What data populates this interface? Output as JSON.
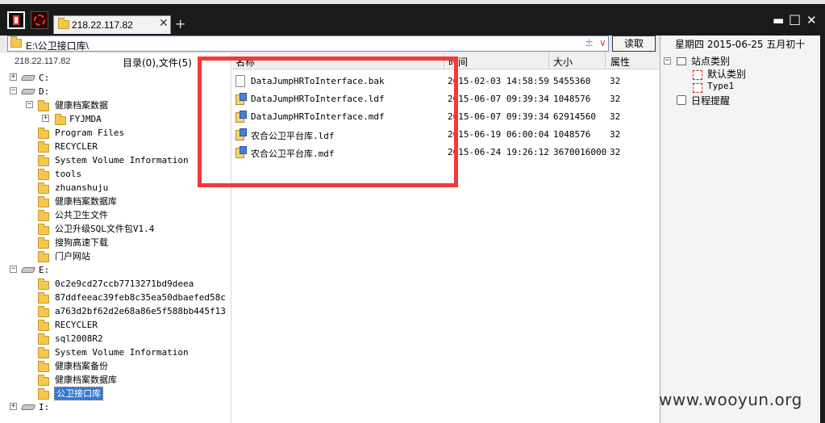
{
  "tab": {
    "title": "218.22.117.82",
    "close": "✕",
    "new_tab": "+"
  },
  "window_controls": {
    "minimize": "▬",
    "maximize": "□",
    "close": "✕"
  },
  "path": {
    "value": "E:\\公卫接口库\\",
    "plusminus": "±",
    "dropdown": "∨",
    "read_button": "读取"
  },
  "left": {
    "host": "218.22.117.82",
    "dir_count": "目录(0),文件(5)",
    "tree": [
      {
        "label": "C:",
        "type": "drive",
        "expander": "+"
      },
      {
        "label": "D:",
        "type": "drive",
        "expander": "−"
      },
      {
        "label": "健康档案数据",
        "type": "folder",
        "expander": "−"
      },
      {
        "label": "FYJMDA",
        "type": "folder",
        "expander": "+"
      },
      {
        "label": "Program Files",
        "type": "folder"
      },
      {
        "label": "RECYCLER",
        "type": "folder"
      },
      {
        "label": "System Volume Information",
        "type": "folder"
      },
      {
        "label": "tools",
        "type": "folder"
      },
      {
        "label": "zhuanshuju",
        "type": "folder"
      },
      {
        "label": "健康档案数据库",
        "type": "folder"
      },
      {
        "label": "公共卫生文件",
        "type": "folder"
      },
      {
        "label": "公卫升级SQL文件包V1.4",
        "type": "folder"
      },
      {
        "label": "搜狗高速下载",
        "type": "folder"
      },
      {
        "label": "门户网站",
        "type": "folder"
      },
      {
        "label": "E:",
        "type": "drive",
        "expander": "−"
      },
      {
        "label": "0c2e9cd27ccb7713271bd9deea",
        "type": "folder"
      },
      {
        "label": "87ddfeeac39feb8c35ea50dbaefed58c",
        "type": "folder"
      },
      {
        "label": "a763d2bf62d2e68a86e5f588bb445f13",
        "type": "folder"
      },
      {
        "label": "RECYCLER",
        "type": "folder"
      },
      {
        "label": "sql2008R2",
        "type": "folder"
      },
      {
        "label": "System Volume Information",
        "type": "folder"
      },
      {
        "label": "健康档案备份",
        "type": "folder"
      },
      {
        "label": "健康档案数据库",
        "type": "folder"
      },
      {
        "label": "公卫接口库",
        "type": "folder",
        "selected": true
      },
      {
        "label": "I:",
        "type": "drive",
        "expander": "+"
      }
    ]
  },
  "files": {
    "columns": {
      "name": "名称",
      "time": "时间",
      "size": "大小",
      "attr": "属性"
    },
    "rows": [
      {
        "name": "DataJumpHRToInterface.bak",
        "time": "2015-02-03 14:58:59",
        "size": "5455360",
        "attr": "32",
        "icon": "doc"
      },
      {
        "name": "DataJumpHRToInterface.ldf",
        "time": "2015-06-07 09:39:34",
        "size": "1048576",
        "attr": "32",
        "icon": "db"
      },
      {
        "name": "DataJumpHRToInterface.mdf",
        "time": "2015-06-07 09:39:34",
        "size": "62914560",
        "attr": "32",
        "icon": "db"
      },
      {
        "name": "农合公卫平台库.ldf",
        "time": "2015-06-19 06:00:04",
        "size": "1048576",
        "attr": "32",
        "icon": "db"
      },
      {
        "name": "农合公卫平台库.mdf",
        "time": "2015-06-24 19:26:12",
        "size": "3670016000",
        "attr": "32",
        "icon": "db"
      }
    ]
  },
  "calendar": {
    "date_line": "星期四 2015-06-25 五月初十",
    "categories_label": "站点类别",
    "default_label": "默认类别",
    "type1_label": "Type1",
    "reminder_label": "日程提醒"
  },
  "watermark": "www.wooyun.org",
  "colors": {
    "highlight_box": "#f03a3a",
    "selection": "#3478d4",
    "titlebar": "#1a1a1a"
  }
}
